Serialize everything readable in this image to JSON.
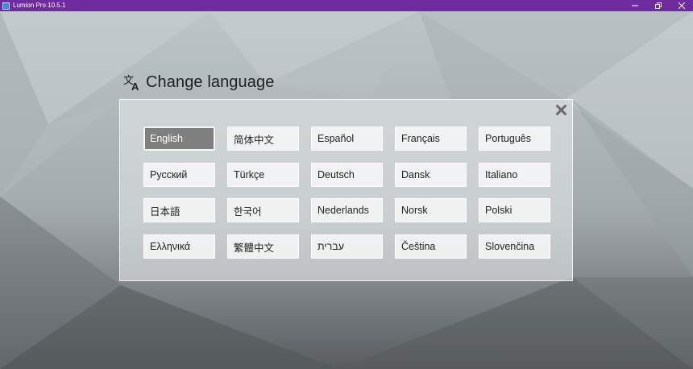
{
  "window": {
    "title": "Lumion Pro 10.5.1",
    "controls": [
      "minimize",
      "restore",
      "close"
    ]
  },
  "heading": {
    "icon": "translate-icon",
    "title": "Change language"
  },
  "languages": [
    [
      "English",
      "简体中文",
      "Español",
      "Français",
      "Português"
    ],
    [
      "Русский",
      "Türkçe",
      "Deutsch",
      "Dansk",
      "Italiano"
    ],
    [
      "日本語",
      "한국어",
      "Nederlands",
      "Norsk",
      "Polski"
    ],
    [
      "Ελληνικά",
      "繁體中文",
      "עברית",
      "Čeština",
      "Slovenčina"
    ]
  ],
  "selected_language": "English",
  "colors": {
    "titlebar": "#6e2c9e",
    "selected_button": "#7f7f7f"
  }
}
